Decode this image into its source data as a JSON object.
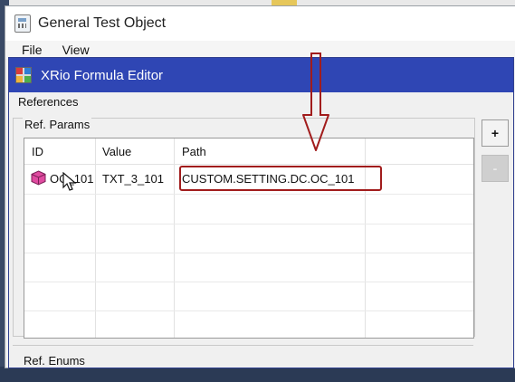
{
  "back_window": {
    "title": "General Test Object",
    "menu": [
      "File",
      "View"
    ]
  },
  "editor": {
    "title": "XRio Formula Editor",
    "references_label": "References",
    "ref_params": {
      "label": "Ref. Params",
      "columns": [
        "ID",
        "Value",
        "Path"
      ],
      "rows": [
        {
          "id": "OC_101",
          "value": "TXT_3_101",
          "path": "CUSTOM.SETTING.DC.OC_101"
        }
      ]
    },
    "buttons": {
      "add": "+",
      "remove": "-"
    },
    "ref_enums_label": "Ref. Enums"
  },
  "colors": {
    "title_bar": "#2f46b4",
    "highlight": "#a11c1c",
    "cube": "#e04aa0"
  },
  "icons": [
    "app-icon",
    "xrio-icon",
    "cube-icon",
    "cursor-icon",
    "down-arrow-icon"
  ]
}
